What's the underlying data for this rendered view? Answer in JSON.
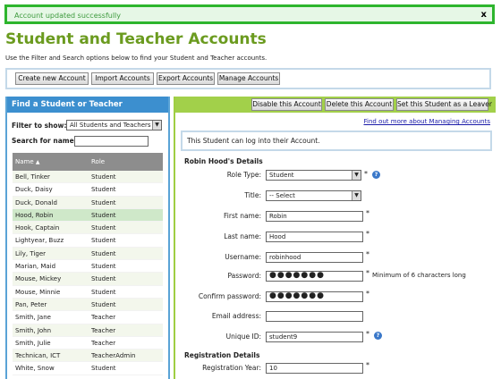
{
  "alert": {
    "message": "Account updated successfully",
    "close_label": "x"
  },
  "page": {
    "title": "Student and Teacher Accounts",
    "intro": "Use the Filter and Search options below to find your Student and Teacher accounts."
  },
  "toolbar": {
    "create": "Create new Account",
    "import": "Import Accounts",
    "export": "Export Accounts",
    "manage": "Manage Accounts"
  },
  "left": {
    "header": "Find a Student or Teacher",
    "filter_label": "Filter to show:",
    "filter_value": "All Students and Teachers",
    "search_label": "Search for name:",
    "search_value": "",
    "columns": {
      "name": "Name",
      "role": "Role"
    },
    "rows": [
      {
        "name": "Bell, Tinker",
        "role": "Student"
      },
      {
        "name": "Duck, Daisy",
        "role": "Student"
      },
      {
        "name": "Duck, Donald",
        "role": "Student"
      },
      {
        "name": "Hood, Robin",
        "role": "Student"
      },
      {
        "name": "Hook, Captain",
        "role": "Student"
      },
      {
        "name": "Lightyear, Buzz",
        "role": "Student"
      },
      {
        "name": "Lily, Tiger",
        "role": "Student"
      },
      {
        "name": "Marian, Maid",
        "role": "Student"
      },
      {
        "name": "Mouse, Mickey",
        "role": "Student"
      },
      {
        "name": "Mouse, Minnie",
        "role": "Student"
      },
      {
        "name": "Pan, Peter",
        "role": "Student"
      },
      {
        "name": "Smith, Jane",
        "role": "Teacher"
      },
      {
        "name": "Smith, John",
        "role": "Teacher"
      },
      {
        "name": "Smith, Julie",
        "role": "Teacher"
      },
      {
        "name": "Technican, ICT",
        "role": "TeacherAdmin"
      },
      {
        "name": "White, Snow",
        "role": "Student"
      }
    ]
  },
  "right": {
    "buttons": {
      "disable": "Disable this Account",
      "delete": "Delete this Account",
      "leaver": "Set this Student as a Leaver"
    },
    "findout": "Find out more about Managing Accounts",
    "info": "This Student can log into their Account.",
    "details_heading": "Robin Hood's Details",
    "labels": {
      "role_type": "Role Type:",
      "title": "Title:",
      "first_name": "First name:",
      "last_name": "Last name:",
      "username": "Username:",
      "password": "Password:",
      "confirm_password": "Confirm password:",
      "email": "Email address:",
      "unique_id": "Unique ID:",
      "registration_year": "Registration Year:"
    },
    "values": {
      "role_type": "Student",
      "title": "-- Select",
      "first_name": "Robin",
      "last_name": "Hood",
      "username": "robinhood",
      "password": "●●●●●●●",
      "confirm_password": "●●●●●●●",
      "email": "",
      "unique_id": "student9",
      "registration_year": "10"
    },
    "password_note": "Minimum of 6 characters long",
    "required_mark": "*",
    "registration_heading": "Registration Details"
  },
  "colors": {
    "accent_green": "#6b9b1f",
    "accent_blue": "#3c8fcf",
    "alert_border": "#2db52d"
  },
  "icons": {
    "help": "help-icon",
    "sort": "sort-arrow-icon",
    "dropdown": "chevron-down-icon"
  }
}
